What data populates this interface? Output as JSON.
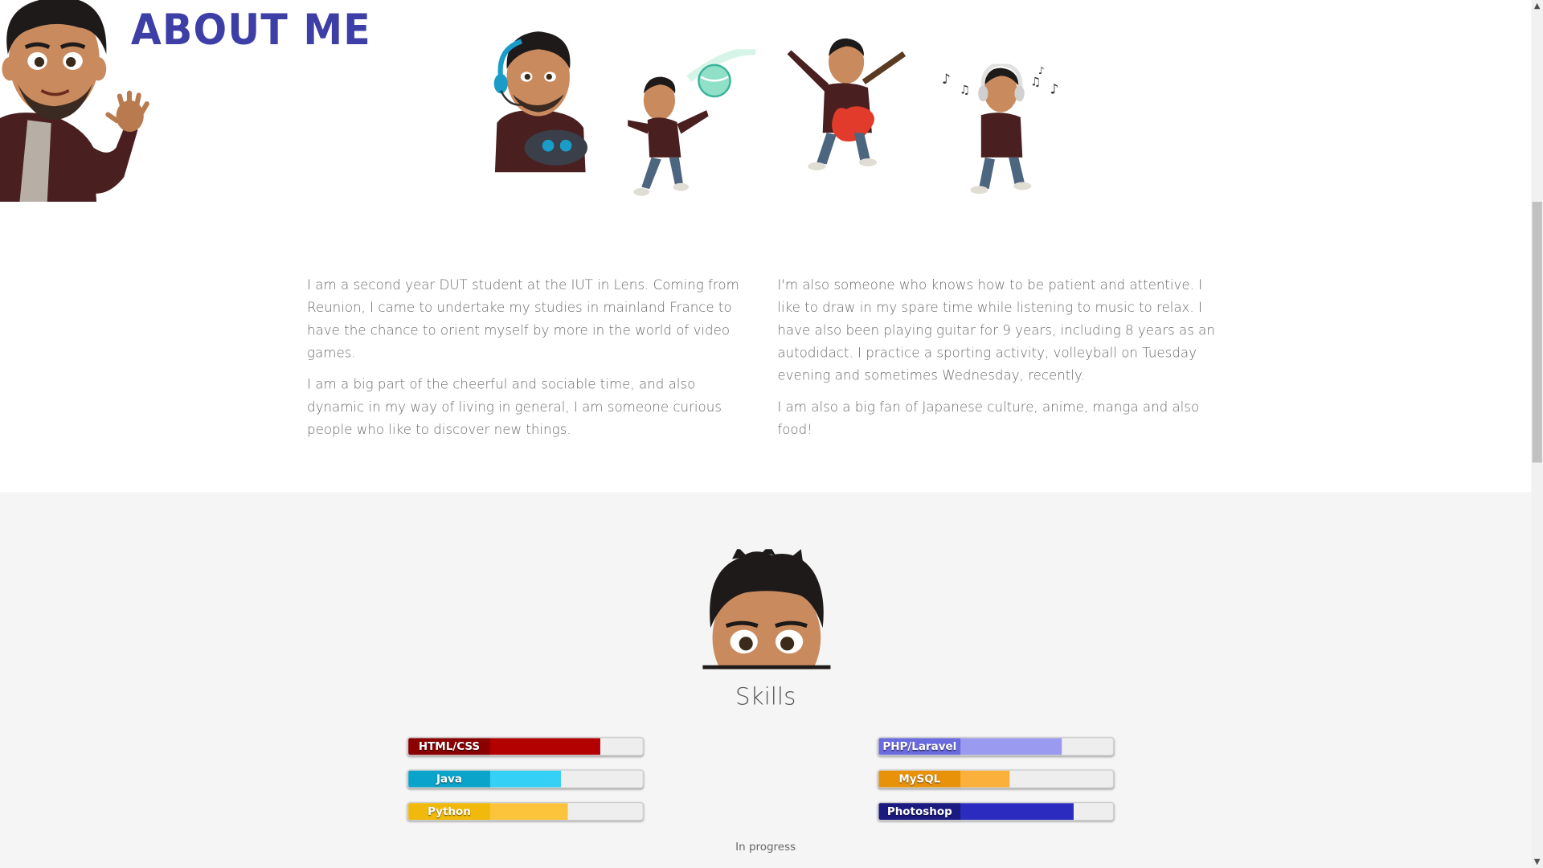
{
  "about": {
    "title": "ABOUT ME",
    "left_paragraphs": [
      "I am a second year DUT student at the IUT in Lens. Coming from Reunion, I came to undertake my studies in mainland France to have the chance to orient myself by more in the world of video games.",
      "I am a big part of the cheerful and sociable time, and also dynamic in my way of living in general, I am someone curious people who like to discover new things."
    ],
    "right_paragraphs": [
      "I'm also someone who knows how to be patient and attentive. I like to draw in my spare time while listening to music to relax. I have also been playing guitar for 9 years, including 8 years as an autodidact. I practice a sporting activity, volleyball on Tuesday evening and sometimes Wednesday, recently.",
      "I am also a big fan of Japanese culture, anime, manga and also food!"
    ],
    "illustrations": [
      "waving-avatar",
      "gaming-avatar",
      "volleyball-avatar",
      "guitar-avatar",
      "music-avatar"
    ]
  },
  "skills": {
    "title": "Skills",
    "footnote": "In progress",
    "items": [
      {
        "name": "HTML/CSS",
        "level": 0.82,
        "label_color": "#8b0000",
        "fill_color": "#b30000"
      },
      {
        "name": "Java",
        "level": 0.65,
        "label_color": "#0aa3c9",
        "fill_color": "#34d0f5"
      },
      {
        "name": "Python",
        "level": 0.68,
        "label_color": "#f0b90b",
        "fill_color": "#fbc43a"
      },
      {
        "name": "PHP/Laravel",
        "level": 0.78,
        "label_color": "#6b6be0",
        "fill_color": "#9a9af0"
      },
      {
        "name": "MySQL",
        "level": 0.56,
        "label_color": "#e8920a",
        "fill_color": "#fbb03b"
      },
      {
        "name": "Photoshop",
        "level": 0.83,
        "label_color": "#1a1a80",
        "fill_color": "#2b2bc0"
      }
    ]
  },
  "colors": {
    "title": "#3d3fa6",
    "section_bg": "#f5f5f5",
    "text": "#6b6b6b"
  }
}
